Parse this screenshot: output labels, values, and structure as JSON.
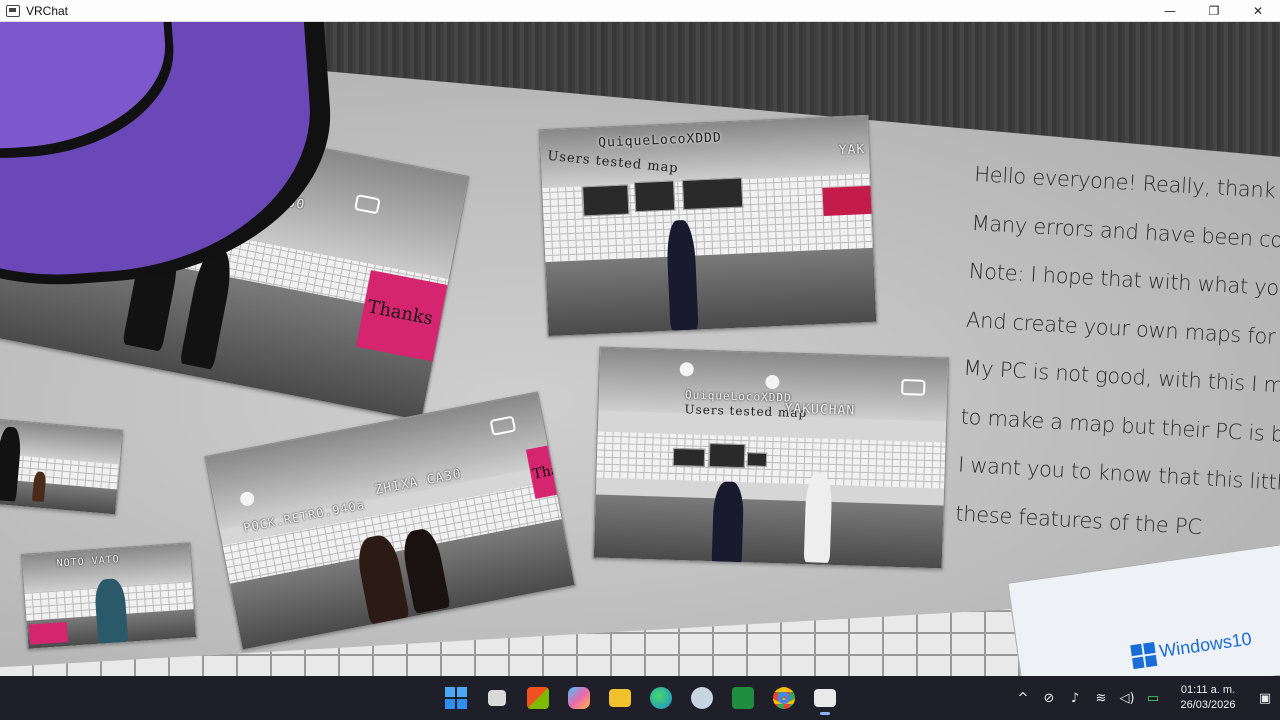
{
  "window": {
    "title": "VRChat",
    "controls": {
      "minimize": "—",
      "maximize": "❐",
      "close": "✕"
    }
  },
  "scene": {
    "photos": [
      {
        "id": "top-left",
        "text": [
          "A CA30"
        ],
        "sign": "Thanks"
      },
      {
        "id": "top-middle",
        "text": [
          "QuiqueLocoXDDD",
          "Users tested map",
          "YAK"
        ]
      },
      {
        "id": "bottom-middle",
        "text": [
          "POCK.RETRO.940a",
          "ZHIXA CA30",
          "Tha"
        ]
      },
      {
        "id": "bottom-right",
        "text": [
          "QuiqueLocoXDDD",
          "Users tested map",
          "YAKUCHAN"
        ]
      },
      {
        "id": "far-left-low",
        "text": [
          "NOTO VATO"
        ]
      }
    ],
    "wall_notes": [
      "Hello everyone! Really, thank you very",
      "Many errors and have been corrected",
      "Note: I hope that with what you are",
      "And create your own maps for the g",
      "My PC is not good, with this I mea",
      "to make a map but their PC is bad",
      "I want you to know that this little m",
      "these features of the PC"
    ],
    "desktop_preview": {
      "brand": "Windows10"
    }
  },
  "taskbar": {
    "apps": [
      {
        "name": "start",
        "icon": "windows-logo-icon",
        "color": "#2f8ff0"
      },
      {
        "name": "task-view",
        "icon": "task-view-icon",
        "color": "#d9d9d9"
      },
      {
        "name": "microsoft-store",
        "icon": "store-icon",
        "color": "#e8e8e8"
      },
      {
        "name": "copilot",
        "icon": "copilot-icon",
        "color": "#e86ab0"
      },
      {
        "name": "file-explorer",
        "icon": "folder-icon",
        "color": "#f2c12e"
      },
      {
        "name": "edge",
        "icon": "edge-icon",
        "color": "#1aa3a3"
      },
      {
        "name": "steam",
        "icon": "steam-icon",
        "color": "#1b2838"
      },
      {
        "name": "spreadsheet",
        "icon": "spreadsheet-icon",
        "color": "#1e8e3e"
      },
      {
        "name": "chrome",
        "icon": "chrome-icon",
        "color": "#e94235"
      },
      {
        "name": "vrchat",
        "icon": "vrchat-icon",
        "color": "#e9e9e9",
        "active": true
      }
    ],
    "tray": {
      "chevron": "^",
      "icons": [
        "network-off-icon",
        "microphone-icon",
        "wifi-icon",
        "speaker-icon",
        "battery-icon"
      ],
      "time": "01:11 a. m.",
      "date": "26/03/2026",
      "notification": "notification-icon"
    }
  }
}
